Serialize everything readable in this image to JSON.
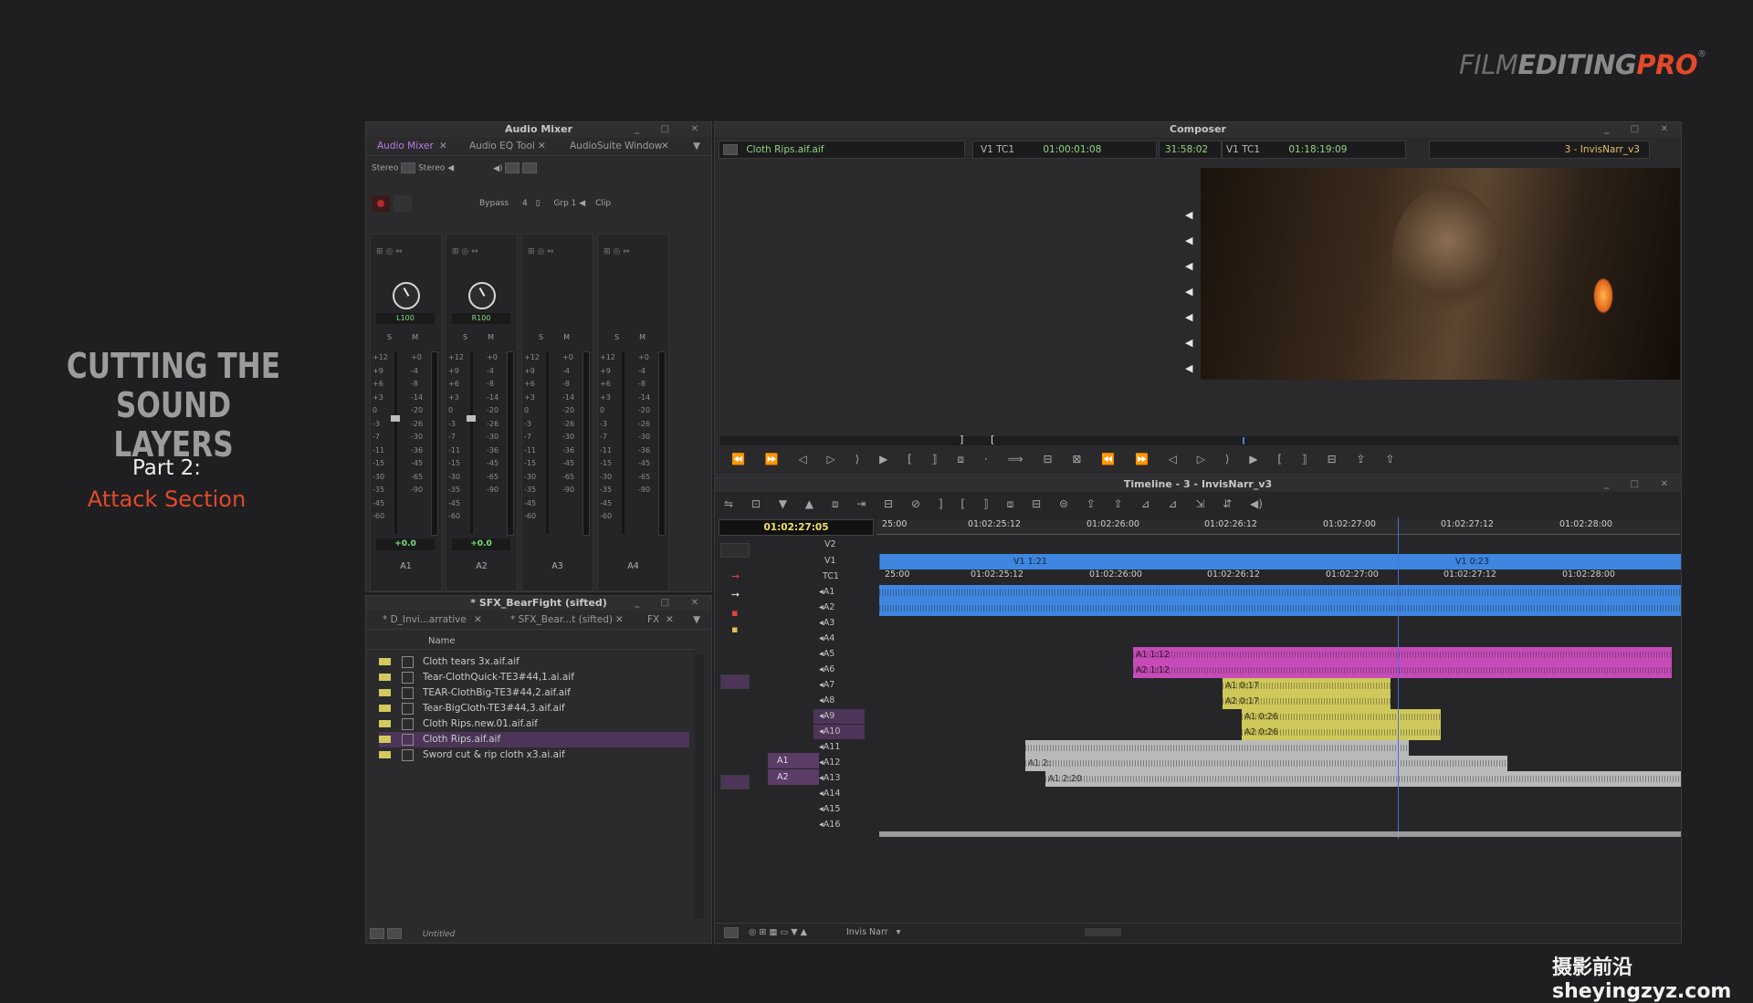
{
  "brand": {
    "part1": "FILM",
    "part2": "EDITING",
    "part3": "PRO",
    "reg": "®"
  },
  "slide": {
    "title_line1": "CUTTING THE",
    "title_line2": "SOUND LAYERS",
    "part": "Part 2:",
    "section": "Attack Section"
  },
  "watermark": "摄影前沿 sheyingzyz.com",
  "audio_mixer": {
    "title": "Audio Mixer",
    "tabs": [
      "Audio Mixer",
      "Audio EQ Tool",
      "AudioSuite Window"
    ],
    "stereo_left": "Stereo",
    "stereo_right": "Stereo",
    "bypass": "Bypass",
    "bypass_num": "4",
    "grp": "Grp 1",
    "clip": "Clip",
    "scale_left": [
      "+12",
      "+9",
      "+6",
      "+3",
      "0",
      "-3",
      "-7",
      "-11",
      "-15",
      "-30",
      "-35",
      "-45",
      "-60"
    ],
    "scale_right": [
      "+0",
      "-4",
      "-8",
      "-14",
      "-20",
      "-26",
      "-30",
      "-36",
      "-45",
      "-65",
      "-90"
    ],
    "channels": [
      {
        "name": "A1",
        "pan": "L100",
        "gain": "+0.0",
        "solo": "S",
        "mute": "M"
      },
      {
        "name": "A2",
        "pan": "R100",
        "gain": "+0.0",
        "solo": "S",
        "mute": "M"
      },
      {
        "name": "A3",
        "pan": "",
        "gain": "",
        "solo": "S",
        "mute": "M"
      },
      {
        "name": "A4",
        "pan": "",
        "gain": "",
        "solo": "S",
        "mute": "M"
      }
    ]
  },
  "bin": {
    "title": "* SFX_BearFight (sifted)",
    "tabs": [
      "* D_Invi...arrative",
      "* SFX_Bear...t (sifted)",
      "FX"
    ],
    "column_name": "Name",
    "items": [
      {
        "name": "Cloth tears 3x.aif.aif",
        "selected": false
      },
      {
        "name": "Tear-ClothQuick-TE3#44,1.ai.aif",
        "selected": false
      },
      {
        "name": "TEAR-ClothBig-TE3#44,2.aif.aif",
        "selected": false
      },
      {
        "name": "Tear-BigCloth-TE3#44,3.aif.aif",
        "selected": false
      },
      {
        "name": "Cloth Rips.new.01.aif.aif",
        "selected": false
      },
      {
        "name": "Cloth Rips.aif.aif",
        "selected": true
      },
      {
        "name": "Sword cut & rip cloth x3.ai.aif",
        "selected": false
      }
    ],
    "footer_view": "Untitled"
  },
  "composer": {
    "title": "Composer",
    "source_clip": "Cloth Rips.aif.aif",
    "source_track": "V1 TC1",
    "source_tc": "01:00:01:08",
    "duration": "31:58:02",
    "record_track": "V1 TC1",
    "record_tc": "01:18:19:09",
    "sequence": "3 - InvisNarr_v3"
  },
  "timeline": {
    "title": "Timeline - 3 - InvisNarr_v3",
    "timecode": "01:02:27:05",
    "ruler": [
      "25:00",
      "01:02:25:12",
      "01:02:26:00",
      "01:02:26:12",
      "01:02:27:00",
      "01:02:27:12",
      "01:02:28:00"
    ],
    "tracks": [
      "V2",
      "V1",
      "TC1",
      "A1",
      "A2",
      "A3",
      "A4",
      "A5",
      "A6",
      "A7",
      "A8",
      "A9",
      "A10",
      "A11",
      "A12",
      "A13",
      "A14",
      "A15",
      "A16"
    ],
    "source_patch": [
      "A1",
      "A2"
    ],
    "clips": {
      "v1_a": "V1 1:21",
      "v1_b": "V1 0:23",
      "a5": "A1 1:12",
      "a6": "A2 1:12",
      "a7": "A1 0:17",
      "a8": "A2 0:17",
      "a9": "A1 0:26",
      "a10": "A2 0:26",
      "a12": "A1 2:",
      "a13": "A1 2:20"
    },
    "footer_seq": "Invis Narr"
  }
}
